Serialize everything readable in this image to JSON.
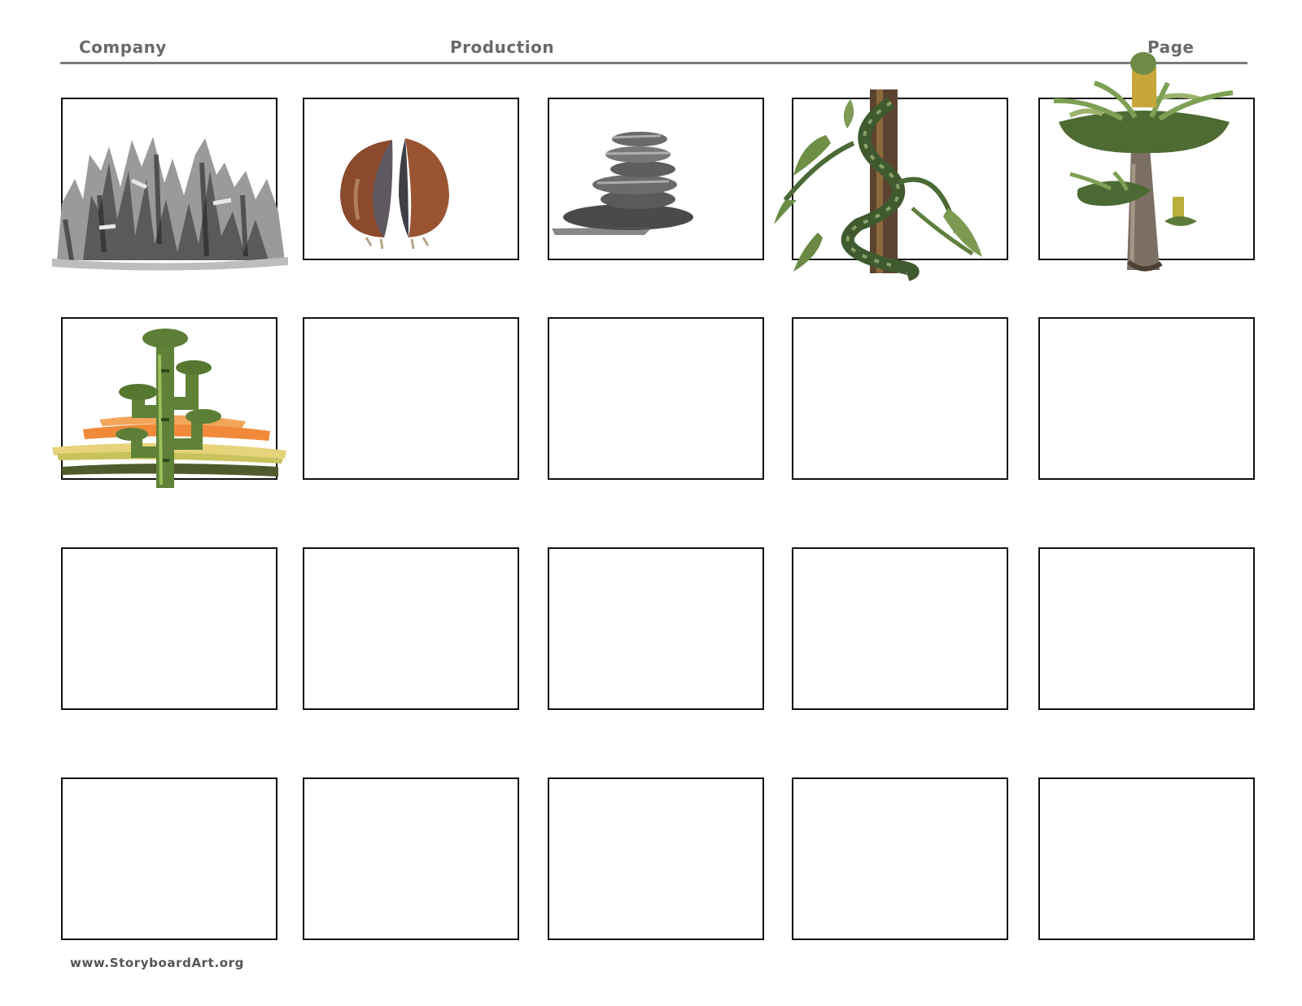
{
  "header": {
    "company_label": "Company",
    "production_label": "Production",
    "page_label": "Page"
  },
  "panels": {
    "rows": 4,
    "columns": 5,
    "illustrations": [
      {
        "panel": 1,
        "subject": "rock-spires-icon"
      },
      {
        "panel": 2,
        "subject": "split-seed-icon"
      },
      {
        "panel": 3,
        "subject": "stacked-stones-icon"
      },
      {
        "panel": 4,
        "subject": "vine-on-trunk-icon"
      },
      {
        "panel": 5,
        "subject": "mushroom-tree-icon"
      },
      {
        "panel": 6,
        "subject": "cactus-sunset-icon"
      }
    ]
  },
  "footer": {
    "url": "www.StoryboardArt.org"
  },
  "colors": {
    "frame": "#111111",
    "header_text": "#6a6a6a",
    "rule": "#7a7a7a"
  }
}
